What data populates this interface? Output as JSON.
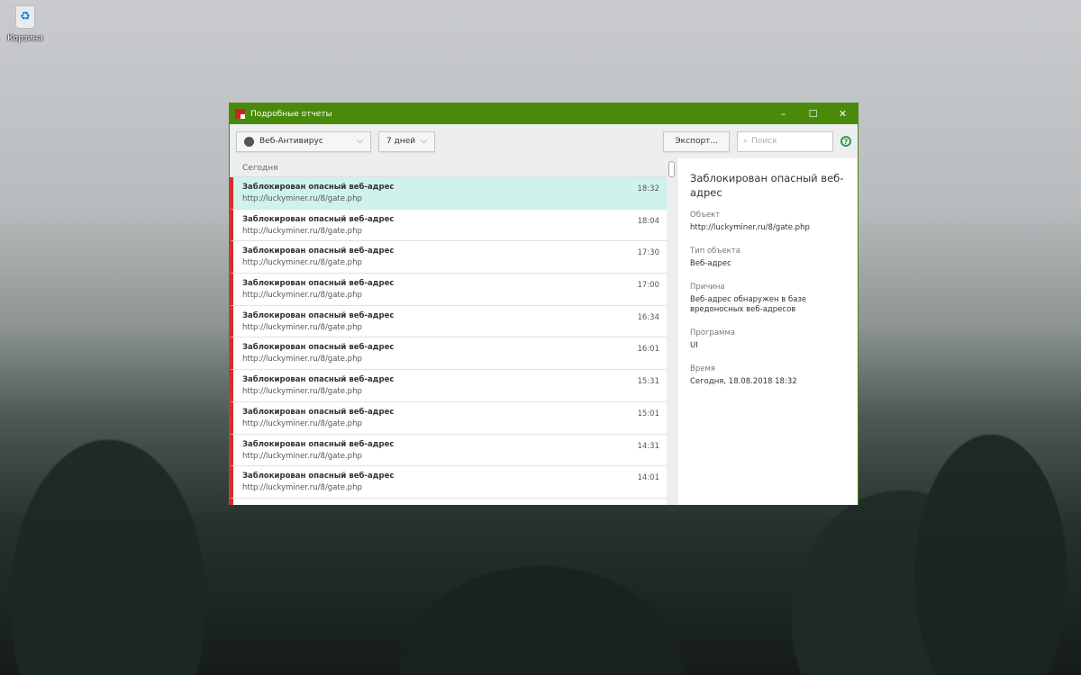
{
  "desktop": {
    "recycle_bin": "Корзина"
  },
  "window": {
    "title": "Подробные отчеты",
    "minimize": "–",
    "maximize": "☐",
    "close": "✕"
  },
  "toolbar": {
    "component": "Веб-Антивирус",
    "period": "7 дней",
    "export": "Экспорт...",
    "search_placeholder": "Поиск",
    "help": "?"
  },
  "list": {
    "group": "Сегодня",
    "items": [
      {
        "title": "Заблокирован опасный веб-адрес",
        "url": "http://luckyminer.ru/8/gate.php",
        "time": "18:32"
      },
      {
        "title": "Заблокирован опасный веб-адрес",
        "url": "http://luckyminer.ru/8/gate.php",
        "time": "18:04"
      },
      {
        "title": "Заблокирован опасный веб-адрес",
        "url": "http://luckyminer.ru/8/gate.php",
        "time": "17:30"
      },
      {
        "title": "Заблокирован опасный веб-адрес",
        "url": "http://luckyminer.ru/8/gate.php",
        "time": "17:00"
      },
      {
        "title": "Заблокирован опасный веб-адрес",
        "url": "http://luckyminer.ru/8/gate.php",
        "time": "16:34"
      },
      {
        "title": "Заблокирован опасный веб-адрес",
        "url": "http://luckyminer.ru/8/gate.php",
        "time": "16:01"
      },
      {
        "title": "Заблокирован опасный веб-адрес",
        "url": "http://luckyminer.ru/8/gate.php",
        "time": "15:31"
      },
      {
        "title": "Заблокирован опасный веб-адрес",
        "url": "http://luckyminer.ru/8/gate.php",
        "time": "15:01"
      },
      {
        "title": "Заблокирован опасный веб-адрес",
        "url": "http://luckyminer.ru/8/gate.php",
        "time": "14:31"
      },
      {
        "title": "Заблокирован опасный веб-адрес",
        "url": "http://luckyminer.ru/8/gate.php",
        "time": "14:01"
      }
    ]
  },
  "detail": {
    "heading": "Заблокирован опасный веб-адрес",
    "fields": [
      {
        "label": "Объект",
        "value": "http://luckyminer.ru/8/gate.php"
      },
      {
        "label": "Тип объекта",
        "value": "Веб-адрес"
      },
      {
        "label": "Причина",
        "value": "Веб-адрес обнаружен в базе вредоносных веб-адресов"
      },
      {
        "label": "Программа",
        "value": "UI"
      },
      {
        "label": "Время",
        "value": "Сегодня, 18.08.2018 18:32"
      }
    ]
  }
}
